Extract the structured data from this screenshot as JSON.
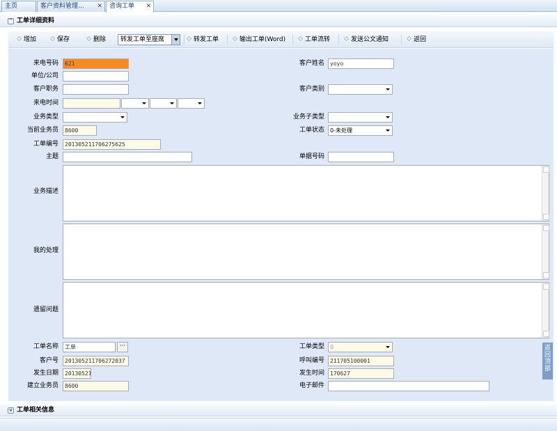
{
  "tabs": [
    {
      "label": "主页",
      "closable": false
    },
    {
      "label": "客户资料管理…",
      "closable": true
    },
    {
      "label": "咨询工单",
      "closable": true
    }
  ],
  "section_top": "工单详细资料",
  "section_bottom": "工单相关信息",
  "toolbar": {
    "add": "增加",
    "save": "保存",
    "delete": "删除",
    "forward_select": "转发工单至座席",
    "forward": "转发工单",
    "export": "输出工单(Word)",
    "flow": "工单流转",
    "notify": "发送公文通知",
    "back": "返回"
  },
  "form": {
    "caller_number": {
      "label": "来电号码",
      "value": "621"
    },
    "customer_name": {
      "label": "客户姓名",
      "value": "yoyo"
    },
    "company": {
      "label": "单位/公司",
      "value": ""
    },
    "customer_job": {
      "label": "客户职务",
      "value": ""
    },
    "customer_type": {
      "label": "客户类别",
      "value": ""
    },
    "call_time": {
      "label": "来电时间",
      "value": ""
    },
    "biz_type": {
      "label": "业务类型",
      "value": ""
    },
    "biz_subtype": {
      "label": "业务子类型",
      "value": ""
    },
    "current_agent": {
      "label": "当前业务员",
      "value": "8600"
    },
    "ticket_status": {
      "label": "工单状态",
      "value": "0-未处理"
    },
    "ticket_no": {
      "label": "工单编号",
      "value": "201305211706275625"
    },
    "subject": {
      "label": "主题",
      "value": ""
    },
    "doc_no": {
      "label": "单据号码",
      "value": ""
    },
    "description": {
      "label": "业务描述",
      "value": ""
    },
    "my_handling": {
      "label": "我的处理",
      "value": ""
    },
    "remaining": {
      "label": "遗留问题",
      "value": ""
    },
    "ticket_name": {
      "label": "工单名称",
      "value": "工单"
    },
    "ticket_type": {
      "label": "工单类型",
      "value": "0"
    },
    "customer_no": {
      "label": "客户号",
      "value": "201305211706272037"
    },
    "call_no": {
      "label": "呼叫编号",
      "value": "211705100001"
    },
    "occur_date": {
      "label": "发生日期",
      "value": "20130521"
    },
    "occur_time": {
      "label": "发生时间",
      "value": "170627"
    },
    "creator": {
      "label": "建立业务员",
      "value": "8600"
    },
    "email": {
      "label": "电子邮件",
      "value": ""
    }
  },
  "back_to_top": "返回顶部",
  "picker_label": "···",
  "colors": {
    "accent": "#15428b",
    "form_bg": "#dfe8f6",
    "highlight": "#f78b1e"
  }
}
